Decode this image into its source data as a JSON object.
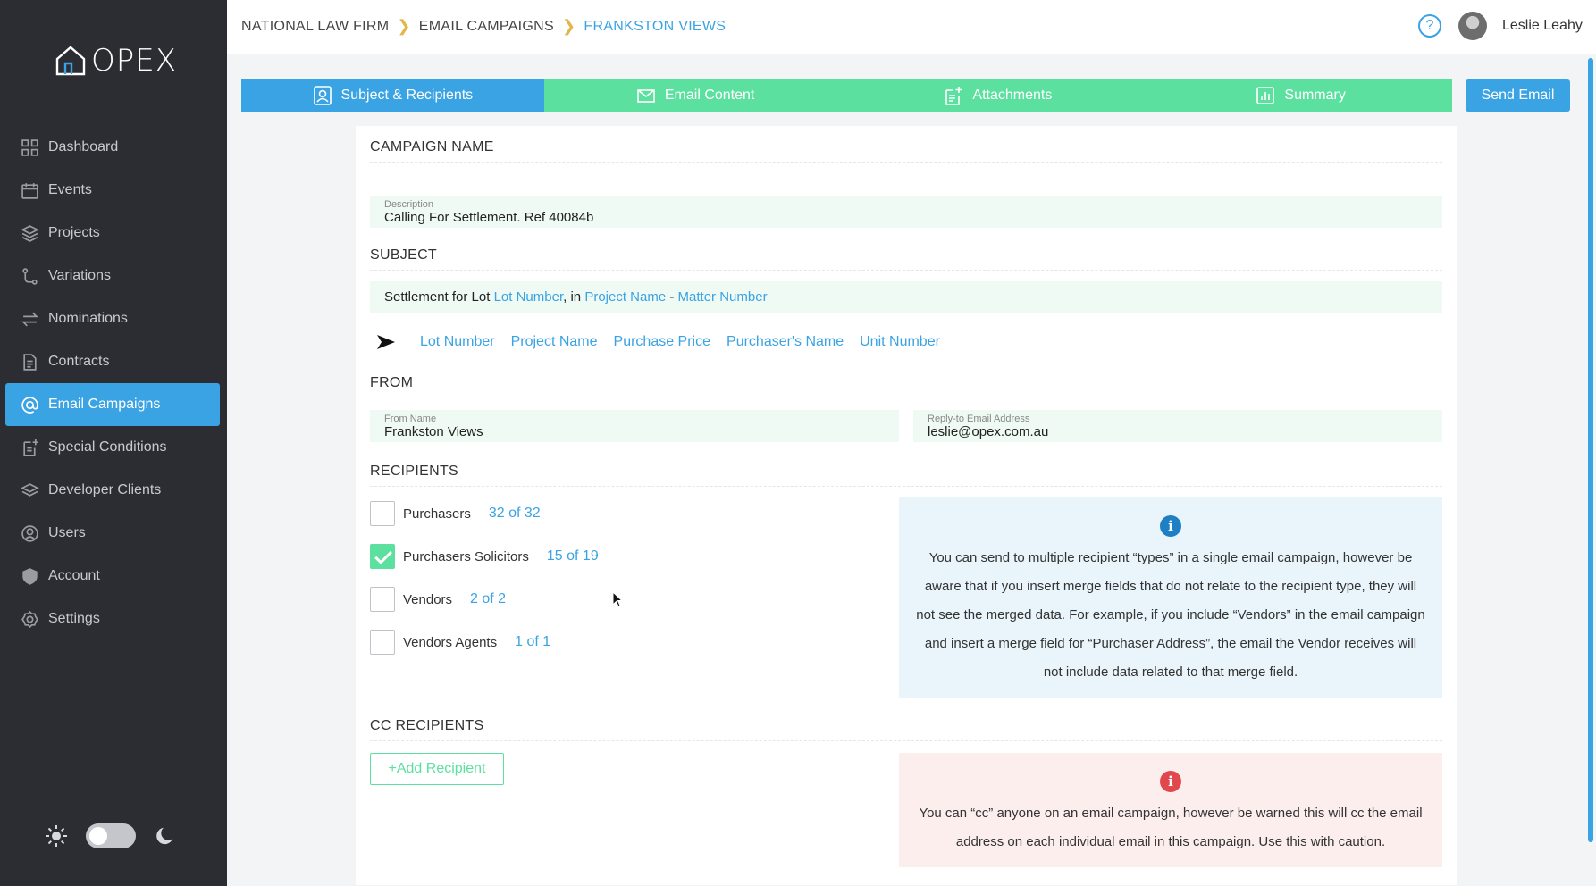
{
  "sidebar": {
    "logo_text": "OPEX",
    "items": [
      {
        "label": "Dashboard",
        "icon": "grid-icon"
      },
      {
        "label": "Events",
        "icon": "calendar-icon"
      },
      {
        "label": "Projects",
        "icon": "layers-icon"
      },
      {
        "label": "Variations",
        "icon": "branch-icon"
      },
      {
        "label": "Nominations",
        "icon": "swap-icon"
      },
      {
        "label": "Contracts",
        "icon": "document-icon"
      },
      {
        "label": "Email Campaigns",
        "icon": "at-icon",
        "active": true
      },
      {
        "label": "Special Conditions",
        "icon": "document-plus-icon"
      },
      {
        "label": "Developer Clients",
        "icon": "stack-icon"
      },
      {
        "label": "Users",
        "icon": "user-icon"
      },
      {
        "label": "Account",
        "icon": "shield-icon"
      },
      {
        "label": "Settings",
        "icon": "gear-icon"
      }
    ]
  },
  "header": {
    "breadcrumb": [
      "NATIONAL LAW FIRM",
      "EMAIL CAMPAIGNS",
      "FRANKSTON VIEWS"
    ],
    "help_symbol": "?",
    "user_name": "Leslie Leahy"
  },
  "tabs": [
    {
      "label": "Subject & Recipients",
      "icon": "user-card-icon",
      "active": true
    },
    {
      "label": "Email Content",
      "icon": "envelope-icon"
    },
    {
      "label": "Attachments",
      "icon": "file-plus-icon"
    },
    {
      "label": "Summary",
      "icon": "bar-chart-icon"
    }
  ],
  "send_email_label": "Send Email",
  "campaign": {
    "section_title": "CAMPAIGN NAME",
    "description_label": "Description",
    "description_value": "Calling For Settlement. Ref 40084b"
  },
  "subject": {
    "section_title": "SUBJECT",
    "parts": {
      "p1": "Settlement for Lot ",
      "mf1": "Lot Number",
      "p2": ", in ",
      "mf2": "Project Name",
      "p3": " - ",
      "mf3": "Matter Number"
    },
    "merge_fields": [
      "Lot Number",
      "Project Name",
      "Purchase Price",
      "Purchaser's Name",
      "Unit Number"
    ]
  },
  "from": {
    "section_title": "FROM",
    "name_label": "From Name",
    "name_value": "Frankston Views",
    "reply_label": "Reply-to Email Address",
    "reply_value": "leslie@opex.com.au"
  },
  "recipients": {
    "section_title": "RECIPIENTS",
    "rows": [
      {
        "label": "Purchasers",
        "count": "32 of 32",
        "checked": false
      },
      {
        "label": "Purchasers Solicitors",
        "count": "15 of 19",
        "checked": true
      },
      {
        "label": "Vendors",
        "count": "2 of 2",
        "checked": false
      },
      {
        "label": "Vendors Agents",
        "count": "1 of 1",
        "checked": false
      }
    ],
    "info_icon": "i",
    "info_text": "You can send to multiple recipient “types” in a single email campaign, however be aware that if you insert merge fields that do not relate to the recipient type, they will not see the merged data. For example, if you include “Vendors” in the email campaign and insert a merge field for “Purchaser Address”, the email the Vendor receives will not include data related to that merge field."
  },
  "cc": {
    "section_title": "CC RECIPIENTS",
    "add_label": "+Add Recipient",
    "warn_icon": "i",
    "warn_text": "You can “cc” anyone on an email campaign, however be warned this will cc the email address on each individual email in this campaign. Use this with caution."
  },
  "colors": {
    "accent": "#3aa3e3",
    "green": "#5ce0a0",
    "sidebar_bg": "#2c2d33"
  }
}
